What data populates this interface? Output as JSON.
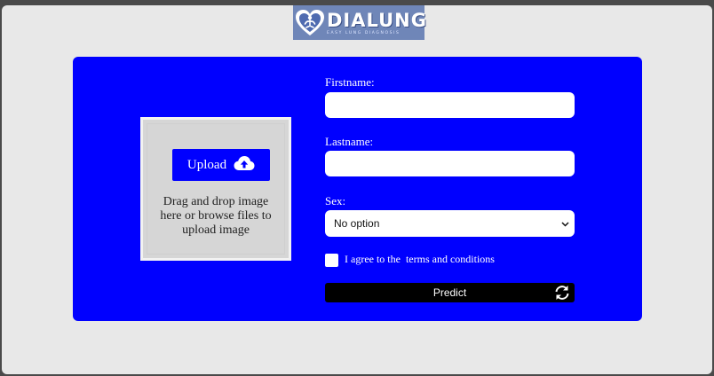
{
  "header": {
    "logo_title": "DIALUNG",
    "logo_tagline": "easy lung diagnosis"
  },
  "upload": {
    "button_label": "Upload",
    "hint": "Drag and drop image here or browse files to upload image"
  },
  "form": {
    "firstname_label": "Firstname:",
    "firstname_value": "",
    "lastname_label": "Lastname:",
    "lastname_value": "",
    "sex_label": "Sex:",
    "sex_selected": "No option",
    "agree_prefix": "I agree to the",
    "terms_link": "terms and conditions",
    "agree_checked": false,
    "predict_label": "Predict"
  },
  "colors": {
    "card": "#0000ff",
    "upload_button": "#0000ff",
    "predict_button": "#000000",
    "page_background": "#e8e8e8"
  },
  "icons": {
    "logo": "heart-lungs-icon",
    "upload": "cloud-upload-icon",
    "predict": "refresh-icon",
    "select": "chevron-down-icon"
  }
}
